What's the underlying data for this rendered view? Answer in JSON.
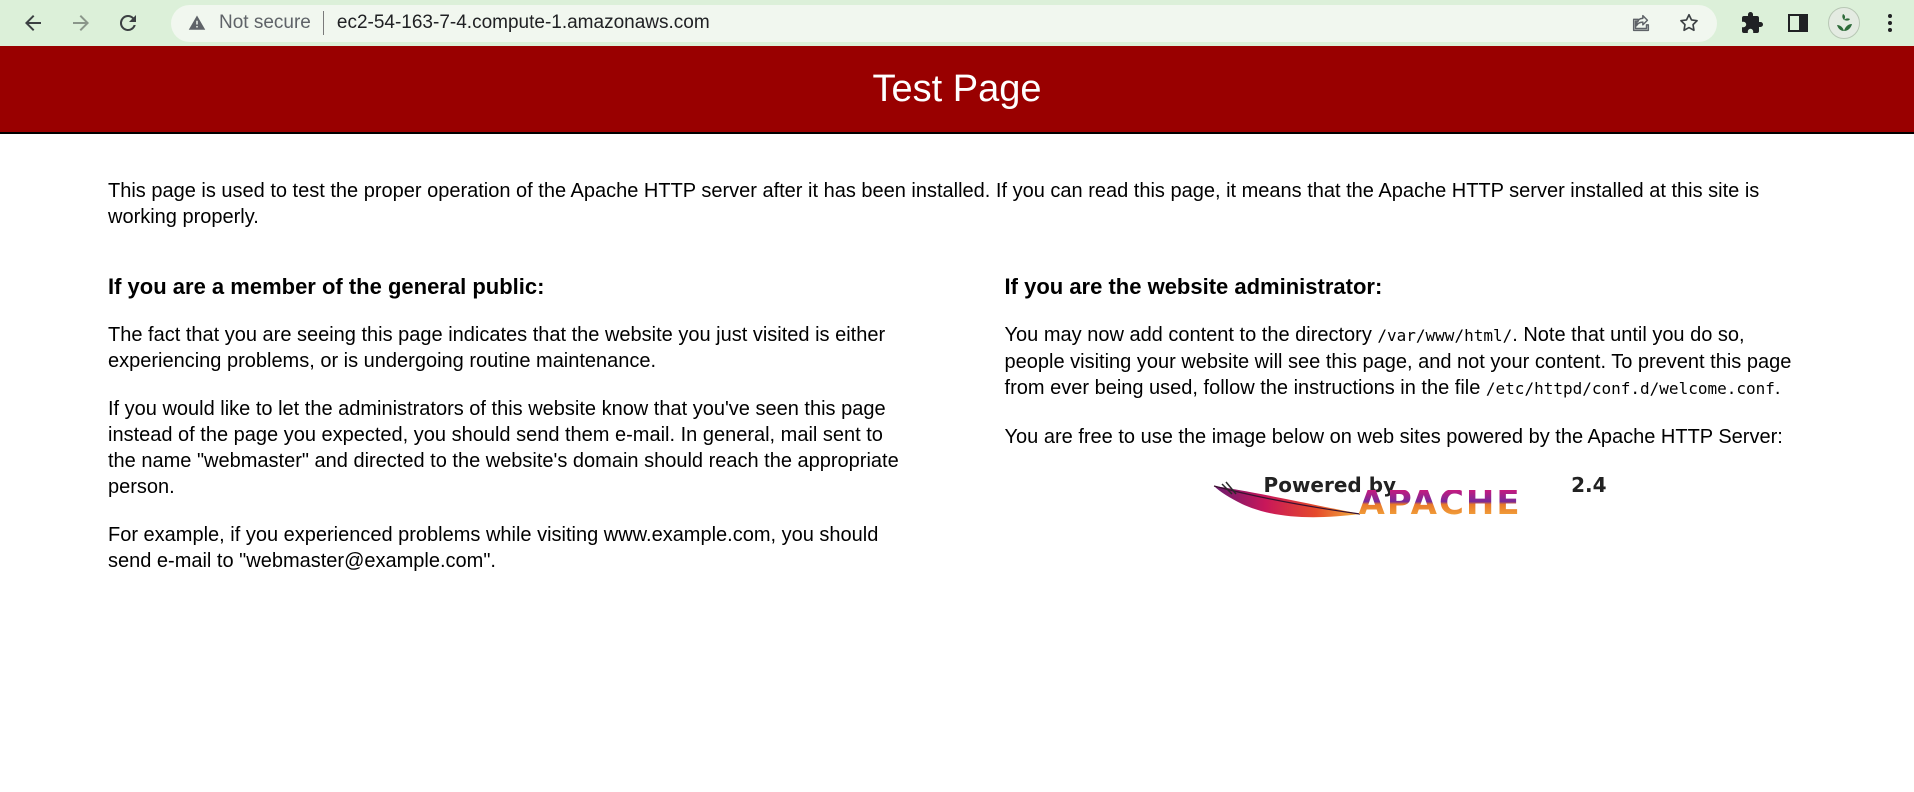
{
  "browser": {
    "security_label": "Not secure",
    "url": "ec2-54-163-7-4.compute-1.amazonaws.com",
    "toolbar_color": "#dcf0d9"
  },
  "page": {
    "banner_title": "Test Page",
    "banner_color": "#990000",
    "intro": "This page is used to test the proper operation of the Apache HTTP server after it has been installed. If you can read this page, it means that the Apache HTTP server installed at this site is working properly.",
    "public": {
      "heading": "If you are a member of the general public:",
      "p1": "The fact that you are seeing this page indicates that the website you just visited is either experiencing problems, or is undergoing routine maintenance.",
      "p2": "If you would like to let the administrators of this website know that you've seen this page instead of the page you expected, you should send them e-mail. In general, mail sent to the name \"webmaster\" and directed to the website's domain should reach the appropriate person.",
      "p3": "For example, if you experienced problems while visiting www.example.com, you should send e-mail to \"webmaster@example.com\"."
    },
    "admin": {
      "heading": "If you are the website administrator:",
      "p1_a": "You may now add content to the directory ",
      "p1_dir": "/var/www/html/",
      "p1_b": ". Note that until you do so, people visiting your website will see this page, and not your content. To prevent this page from ever being used, follow the instructions in the file ",
      "p1_file": "/etc/httpd/conf.d/welcome.conf",
      "p1_c": ".",
      "p2": "You are free to use the image below on web sites powered by the Apache HTTP Server:",
      "badge": {
        "powered_by": "Powered by",
        "version": "2.4",
        "brand": "APACHE"
      }
    }
  }
}
